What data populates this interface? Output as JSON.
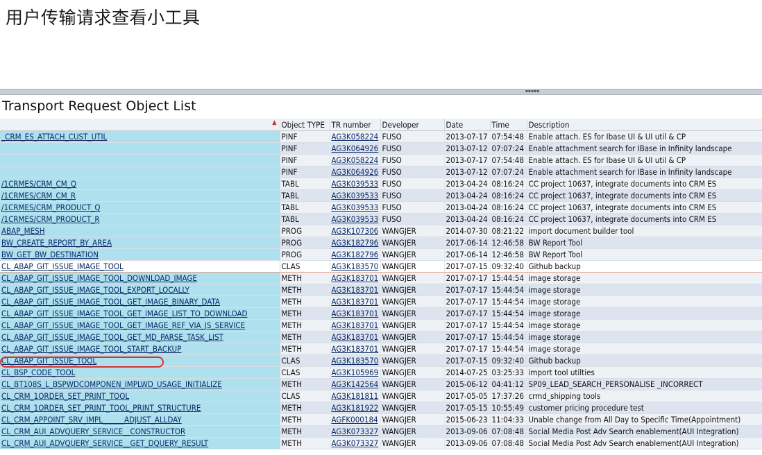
{
  "page": {
    "title": "用户传输请求查看小工具"
  },
  "list": {
    "title": "Transport Request Object List"
  },
  "columns": [
    "",
    "Object TYPE",
    "TR number",
    "Developer",
    "Date",
    "Time",
    "Description"
  ],
  "rows": [
    {
      "obj": "_CRM_ES_ATTACH_CUST_UTIL",
      "type": "PINF",
      "tr": "AG3K058224",
      "dev": "FUSO",
      "date": "2013-07-17",
      "time": "07:54:48",
      "desc": "Enable attach. ES for Ibase UI & UI util & CP"
    },
    {
      "obj": "",
      "type": "PINF",
      "tr": "AG3K064926",
      "dev": "FUSO",
      "date": "2013-07-12",
      "time": "07:07:24",
      "desc": "Enable attachment search for IBase in Infinity landscape"
    },
    {
      "obj": "",
      "type": "PINF",
      "tr": "AG3K058224",
      "dev": "FUSO",
      "date": "2013-07-17",
      "time": "07:54:48",
      "desc": "Enable attach. ES for Ibase UI & UI util & CP"
    },
    {
      "obj": "",
      "type": "PINF",
      "tr": "AG3K064926",
      "dev": "FUSO",
      "date": "2013-07-12",
      "time": "07:07:24",
      "desc": "Enable attachment search for IBase in Infinity landscape"
    },
    {
      "obj": "/1CRMES/CRM_CM_Q",
      "type": "TABL",
      "tr": "AG3K039533",
      "dev": "FUSO",
      "date": "2013-04-24",
      "time": "08:16:24",
      "desc": "CC project 10637, integrate documents into CRM ES"
    },
    {
      "obj": "/1CRMES/CRM_CM_R",
      "type": "TABL",
      "tr": "AG3K039533",
      "dev": "FUSO",
      "date": "2013-04-24",
      "time": "08:16:24",
      "desc": "CC project 10637, integrate documents into CRM ES"
    },
    {
      "obj": "/1CRMES/CRM_PRODUCT_Q",
      "type": "TABL",
      "tr": "AG3K039533",
      "dev": "FUSO",
      "date": "2013-04-24",
      "time": "08:16:24",
      "desc": "CC project 10637, integrate documents into CRM ES"
    },
    {
      "obj": "/1CRMES/CRM_PRODUCT_R",
      "type": "TABL",
      "tr": "AG3K039533",
      "dev": "FUSO",
      "date": "2013-04-24",
      "time": "08:16:24",
      "desc": "CC project 10637, integrate documents into CRM ES"
    },
    {
      "obj": "ABAP_MESH",
      "type": "PROG",
      "tr": "AG3K107306",
      "dev": "WANGJER",
      "date": "2014-07-30",
      "time": "08:21:22",
      "desc": "import document builder tool"
    },
    {
      "obj": "BW_CREATE_REPORT_BY_AREA",
      "type": "PROG",
      "tr": "AG3K182796",
      "dev": "WANGJER",
      "date": "2017-06-14",
      "time": "12:46:58",
      "desc": "BW Report Tool"
    },
    {
      "obj": "BW_GET_BW_DESTINATION",
      "type": "PROG",
      "tr": "AG3K182796",
      "dev": "WANGJER",
      "date": "2017-06-14",
      "time": "12:46:58",
      "desc": "BW Report Tool"
    },
    {
      "obj": "CL_ABAP_GIT_ISSUE_IMAGE_TOOL",
      "type": "CLAS",
      "tr": "AG3K183570",
      "dev": "WANGJER",
      "date": "2017-07-15",
      "time": "09:32:40",
      "desc": "Github backup",
      "selected": true
    },
    {
      "obj": "CL_ABAP_GIT_ISSUE_IMAGE_TOOL_DOWNLOAD_IMAGE",
      "type": "METH",
      "tr": "AG3K183701",
      "dev": "WANGJER",
      "date": "2017-07-17",
      "time": "15:44:54",
      "desc": "image storage"
    },
    {
      "obj": "CL_ABAP_GIT_ISSUE_IMAGE_TOOL_EXPORT_LOCALLY",
      "type": "METH",
      "tr": "AG3K183701",
      "dev": "WANGJER",
      "date": "2017-07-17",
      "time": "15:44:54",
      "desc": "image storage"
    },
    {
      "obj": "CL_ABAP_GIT_ISSUE_IMAGE_TOOL_GET_IMAGE_BINARY_DATA",
      "type": "METH",
      "tr": "AG3K183701",
      "dev": "WANGJER",
      "date": "2017-07-17",
      "time": "15:44:54",
      "desc": "image storage"
    },
    {
      "obj": "CL_ABAP_GIT_ISSUE_IMAGE_TOOL_GET_IMAGE_LIST_TO_DOWNLOAD",
      "type": "METH",
      "tr": "AG3K183701",
      "dev": "WANGJER",
      "date": "2017-07-17",
      "time": "15:44:54",
      "desc": "image storage"
    },
    {
      "obj": "CL_ABAP_GIT_ISSUE_IMAGE_TOOL_GET_IMAGE_REF_VIA_JS_SERVICE",
      "type": "METH",
      "tr": "AG3K183701",
      "dev": "WANGJER",
      "date": "2017-07-17",
      "time": "15:44:54",
      "desc": "image storage"
    },
    {
      "obj": "CL_ABAP_GIT_ISSUE_IMAGE_TOOL_GET_MD_PARSE_TASK_LIST",
      "type": "METH",
      "tr": "AG3K183701",
      "dev": "WANGJER",
      "date": "2017-07-17",
      "time": "15:44:54",
      "desc": "image storage"
    },
    {
      "obj": "CL_ABAP_GIT_ISSUE_IMAGE_TOOL_START_BACKUP",
      "type": "METH",
      "tr": "AG3K183701",
      "dev": "WANGJER",
      "date": "2017-07-17",
      "time": "15:44:54",
      "desc": "image storage"
    },
    {
      "obj": "CL_ABAP_GIT_ISSUE_TOOL",
      "type": "CLAS",
      "tr": "AG3K183570",
      "dev": "WANGJER",
      "date": "2017-07-15",
      "time": "09:32:40",
      "desc": "Github backup"
    },
    {
      "obj": "CL_BSP_CODE_TOOL",
      "type": "CLAS",
      "tr": "AG3K105969",
      "dev": "WANGJER",
      "date": "2014-07-25",
      "time": "03:25:33",
      "desc": "import tool utilties"
    },
    {
      "obj": "CL_BT108S_L_BSPWDCOMPONEN_IMPLWD_USAGE_INITIALIZE",
      "type": "METH",
      "tr": "AG3K142564",
      "dev": "WANGJER",
      "date": "2015-06-12",
      "time": "04:41:12",
      "desc": "SP09_LEAD_SEARCH_PERSONALISE _INCORRECT"
    },
    {
      "obj": "CL_CRM_1ORDER_SET_PRINT_TOOL",
      "type": "CLAS",
      "tr": "AG3K181811",
      "dev": "WANGJER",
      "date": "2017-05-05",
      "time": "17:37:26",
      "desc": "crmd_shipping tools"
    },
    {
      "obj": "CL_CRM_1ORDER_SET_PRINT_TOOL_PRINT_STRUCTURE",
      "type": "METH",
      "tr": "AG3K181922",
      "dev": "WANGJER",
      "date": "2017-05-15",
      "time": "10:55:49",
      "desc": "customer pricing procedure test"
    },
    {
      "obj": "CL_CRM_APPOINT_SRV_IMPL______ADJUST_ALLDAY",
      "type": "METH",
      "tr": "AGFK000184",
      "dev": "WANGJER",
      "date": "2015-06-23",
      "time": "11:04:33",
      "desc": "Unable change from All Day to Specific Time(Appointment)"
    },
    {
      "obj": "CL_CRM_AUI_ADVQUERY_SERVICE__CONSTRUCTOR",
      "type": "METH",
      "tr": "AG3K073327",
      "dev": "WANGJER",
      "date": "2013-09-06",
      "time": "07:08:48",
      "desc": "Social Media Post Adv Search enablement(AUI Integration)"
    },
    {
      "obj": "CL_CRM_AUI_ADVQUERY_SERVICE__GET_DQUERY_RESULT",
      "type": "METH",
      "tr": "AG3K073327",
      "dev": "WANGJER",
      "date": "2013-09-06",
      "time": "07:08:48",
      "desc": "Social Media Post Adv Search enablement(AUI Integration)"
    }
  ]
}
